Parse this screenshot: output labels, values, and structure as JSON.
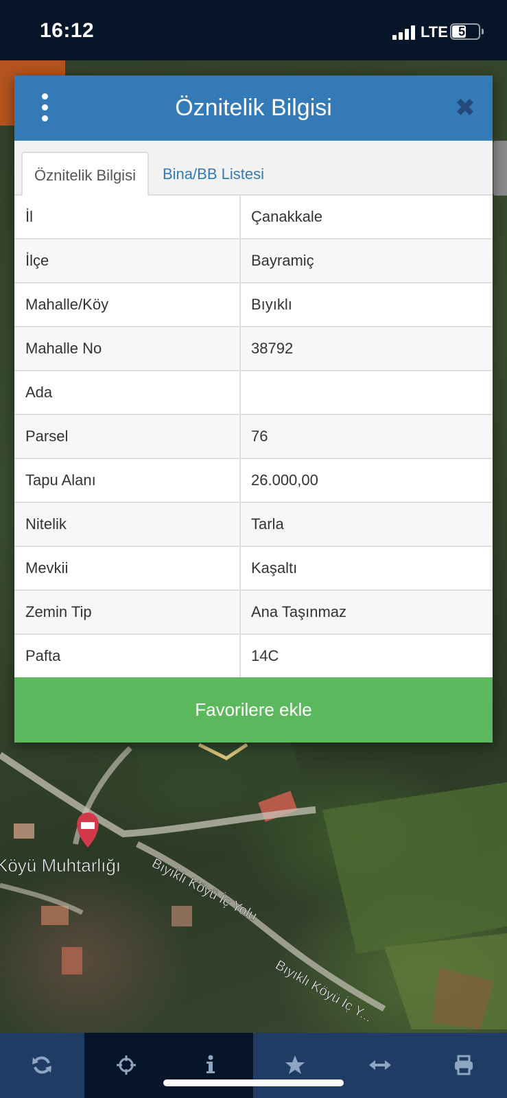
{
  "status_bar": {
    "time": "16:12",
    "network": "LTE",
    "battery_level": "51",
    "battery_fraction": 0.51
  },
  "map": {
    "labels": [
      "Köyü Muhtarlığı",
      "Bıyıklı Köyü İç Yolu",
      "Bıyıklı Köyü İç Y..."
    ]
  },
  "modal": {
    "title": "Öznitelik Bilgisi",
    "tabs": [
      {
        "label": "Öznitelik Bilgisi",
        "active": true
      },
      {
        "label": "Bina/BB Listesi",
        "active": false
      }
    ],
    "rows": [
      {
        "key": "İl",
        "value": "Çanakkale"
      },
      {
        "key": "İlçe",
        "value": "Bayramiç"
      },
      {
        "key": "Mahalle/Köy",
        "value": "Bıyıklı"
      },
      {
        "key": "Mahalle No",
        "value": "38792"
      },
      {
        "key": "Ada",
        "value": ""
      },
      {
        "key": "Parsel",
        "value": "76"
      },
      {
        "key": "Tapu Alanı",
        "value": "26.000,00"
      },
      {
        "key": "Nitelik",
        "value": "Tarla"
      },
      {
        "key": "Mevkii",
        "value": "Kaşaltı"
      },
      {
        "key": "Zemin Tip",
        "value": "Ana Taşınmaz"
      },
      {
        "key": "Pafta",
        "value": "14C"
      }
    ],
    "favorite_label": "Favorilere ekle"
  },
  "toolbar": {
    "items": [
      {
        "icon": "refresh-icon",
        "active": false
      },
      {
        "icon": "crosshair-icon",
        "active": true
      },
      {
        "icon": "info-icon",
        "active": true
      },
      {
        "icon": "star-icon",
        "active": false
      },
      {
        "icon": "horizontal-arrows-icon",
        "active": false
      },
      {
        "icon": "print-icon",
        "active": false
      }
    ]
  },
  "colors": {
    "header_blue": "#337ab7",
    "favorite_green": "#5cb85c",
    "status_bar_bg": "#06152a",
    "toolbar_bg": "#1f3d64",
    "map_marker": "#d23a4a"
  }
}
